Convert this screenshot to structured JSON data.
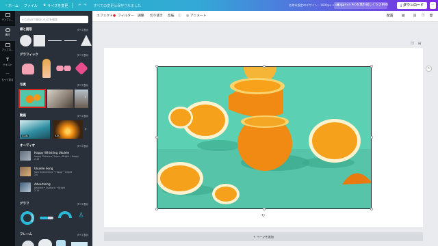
{
  "topbar": {
    "home": "ホーム",
    "file": "ファイル",
    "resize": "サイズを変更",
    "save_status": "すべての変更は保存されました",
    "doc_title": "名称未設定のデザイン - 1600px × 900px",
    "pro_cta": "Canva Proを無料試しください",
    "share": "共有",
    "download": "ダウンロード",
    "more": "···"
  },
  "rail": [
    {
      "label": "テンプレ…",
      "icon": "template-icon"
    },
    {
      "label": "素材",
      "icon": "elements-icon",
      "active": true
    },
    {
      "label": "アップロ…",
      "icon": "upload-icon"
    },
    {
      "label": "テキスト",
      "icon": "text-icon"
    },
    {
      "label": "もっと見る",
      "icon": "more-icon"
    }
  ],
  "panel": {
    "search_placeholder": "Canvaで面白いものを検索",
    "see_all": "すべて表示",
    "sections": {
      "shapes": "線と図形",
      "graphics": "グラフィック",
      "photos": "写真",
      "videos": "動画",
      "audio": "オーディオ",
      "charts": "グラフ",
      "frames": "フレーム"
    },
    "video_durations": [
      "41.8s",
      "6.0s"
    ],
    "audio_tracks": [
      {
        "title": "Happy Whistling Ukulele",
        "sub": "Happy Childrens' Tunes • Bright • Happy",
        "dur": "2:16"
      },
      {
        "title": "Ukulele Song",
        "sub": "Sam Instruments • Happy • Bright",
        "dur": "2:0"
      },
      {
        "title": "Advertising",
        "sub": "Ambient • Euphoric • Bright",
        "dur": "2:14"
      }
    ]
  },
  "toolbar": {
    "effects": "エフェクト",
    "filter": "フィルター",
    "adjust": "調整",
    "crop": "切り抜き",
    "flip": "反転",
    "animate": "アニメート",
    "arrange": "配置"
  },
  "canvas": {
    "add_page": "+ ページを追加"
  },
  "colors": {
    "accent": "#7d2ae8",
    "teal": "#23b6c6",
    "panel_bg": "#293039",
    "photo_bg": "#5bd0b2",
    "orange": "#f08a12"
  }
}
